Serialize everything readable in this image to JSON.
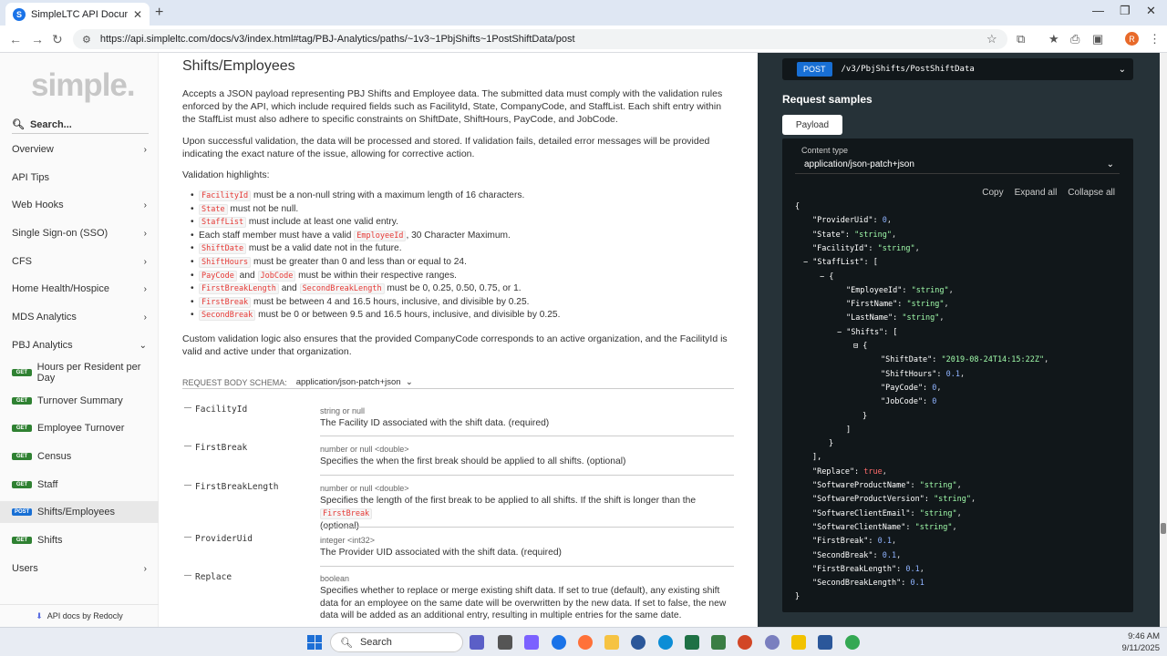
{
  "browser": {
    "tab_title": "SimpleLTC API Documentation",
    "url": "https://api.simpleltc.com/docs/v3/index.html#tag/PBJ-Analytics/paths/~1v3~1PbjShifts~1PostShiftData/post",
    "profile_initial": "R"
  },
  "sidebar": {
    "logo": "simple.",
    "search_placeholder": "Search...",
    "items": [
      {
        "label": "Overview",
        "chevron": "›"
      },
      {
        "label": "API Tips",
        "chevron": ""
      },
      {
        "label": "Web Hooks",
        "chevron": "›"
      },
      {
        "label": "Single Sign-on (SSO)",
        "chevron": "›"
      },
      {
        "label": "CFS",
        "chevron": "›"
      },
      {
        "label": "Home Health/Hospice",
        "chevron": "›"
      },
      {
        "label": "MDS Analytics",
        "chevron": "›"
      },
      {
        "label": "PBJ Analytics",
        "chevron": "⌄"
      }
    ],
    "sub_items": [
      {
        "method": "GET",
        "label": "Hours per Resident per Day"
      },
      {
        "method": "GET",
        "label": "Turnover Summary"
      },
      {
        "method": "GET",
        "label": "Employee Turnover"
      },
      {
        "method": "GET",
        "label": "Census"
      },
      {
        "method": "GET",
        "label": "Staff"
      },
      {
        "method": "POST",
        "label": "Shifts/Employees"
      },
      {
        "method": "GET",
        "label": "Shifts"
      }
    ],
    "users": {
      "label": "Users",
      "chevron": "›"
    },
    "footer": "API docs by Redocly"
  },
  "main": {
    "title": "Shifts/Employees",
    "para1": "Accepts a JSON payload representing PBJ Shifts and Employee data. The submitted data must comply with the validation rules enforced by the API, which include required fields such as FacilityId, State, CompanyCode, and StaffList. Each shift entry within the StaffList must also adhere to specific constraints on ShiftDate, ShiftHours, PayCode, and JobCode.",
    "para2": "Upon successful validation, the data will be processed and stored. If validation fails, detailed error messages will be provided indicating the exact nature of the issue, allowing for corrective action.",
    "para3": "Validation highlights:",
    "validation": [
      {
        "c1": "FacilityId",
        "t1": " must be a non-null string with a maximum length of 16 characters."
      },
      {
        "c1": "State",
        "t1": " must not be null."
      },
      {
        "c1": "StaffList",
        "t1": " must include at least one valid entry."
      },
      {
        "pre": "Each staff member must have a valid ",
        "c1": "EmployeeId",
        "t1": ", 30 Character Maximum."
      },
      {
        "c1": "ShiftDate",
        "t1": " must be a valid date not in the future."
      },
      {
        "c1": "ShiftHours",
        "t1": " must be greater than 0 and less than or equal to 24."
      },
      {
        "c1": "PayCode",
        "t1": " and ",
        "c2": "JobCode",
        "t2": " must be within their respective ranges."
      },
      {
        "c1": "FirstBreakLength",
        "t1": " and ",
        "c2": "SecondBreakLength",
        "t2": " must be 0, 0.25, 0.50, 0.75, or 1."
      },
      {
        "c1": "FirstBreak",
        "t1": " must be between 4 and 16.5 hours, inclusive, and divisible by 0.25."
      },
      {
        "c1": "SecondBreak",
        "t1": " must be 0 or between 9.5 and 16.5 hours, inclusive, and divisible by 0.25."
      }
    ],
    "para4": "Custom validation logic also ensures that the provided CompanyCode corresponds to an active organization, and the FacilityId is valid and active under that organization.",
    "schema_label": "REQUEST BODY SCHEMA:",
    "schema_content_type": "application/json-patch+json",
    "fields": [
      {
        "name": "FacilityId",
        "type": "string or null",
        "desc": "The Facility ID associated with the shift data. (required)"
      },
      {
        "name": "FirstBreak",
        "type": "number or null <double>",
        "desc": "Specifies the when the first break should be applied to all shifts. (optional)"
      },
      {
        "name": "FirstBreakLength",
        "type": "number or null <double>",
        "desc": "Specifies the length of the first break to be applied to all shifts. If the shift is longer than the",
        "desc_code": "FirstBreak",
        "desc2": "(optional)"
      },
      {
        "name": "ProviderUid",
        "type": "integer <int32>",
        "desc": "The Provider UID associated with the shift data. (required)"
      },
      {
        "name": "Replace",
        "type": "boolean",
        "desc": "Specifies whether to replace or merge existing shift data. If set to true (default), any existing shift data for an employee on the same date will be overwritten by the new data. If set to false, the new data will be added as an additional entry, resulting in multiple entries for the same date."
      }
    ]
  },
  "right": {
    "method": "POST",
    "path": "/v3/PbjShifts/PostShiftData",
    "samples_title": "Request samples",
    "payload_tab": "Payload",
    "content_type_label": "Content type",
    "content_type": "application/json-patch+json",
    "actions": {
      "copy": "Copy",
      "expand": "Expand all",
      "collapse": "Collapse all"
    }
  },
  "taskbar": {
    "search": "Search",
    "time": "9:46 AM",
    "date": "9/11/2025"
  }
}
